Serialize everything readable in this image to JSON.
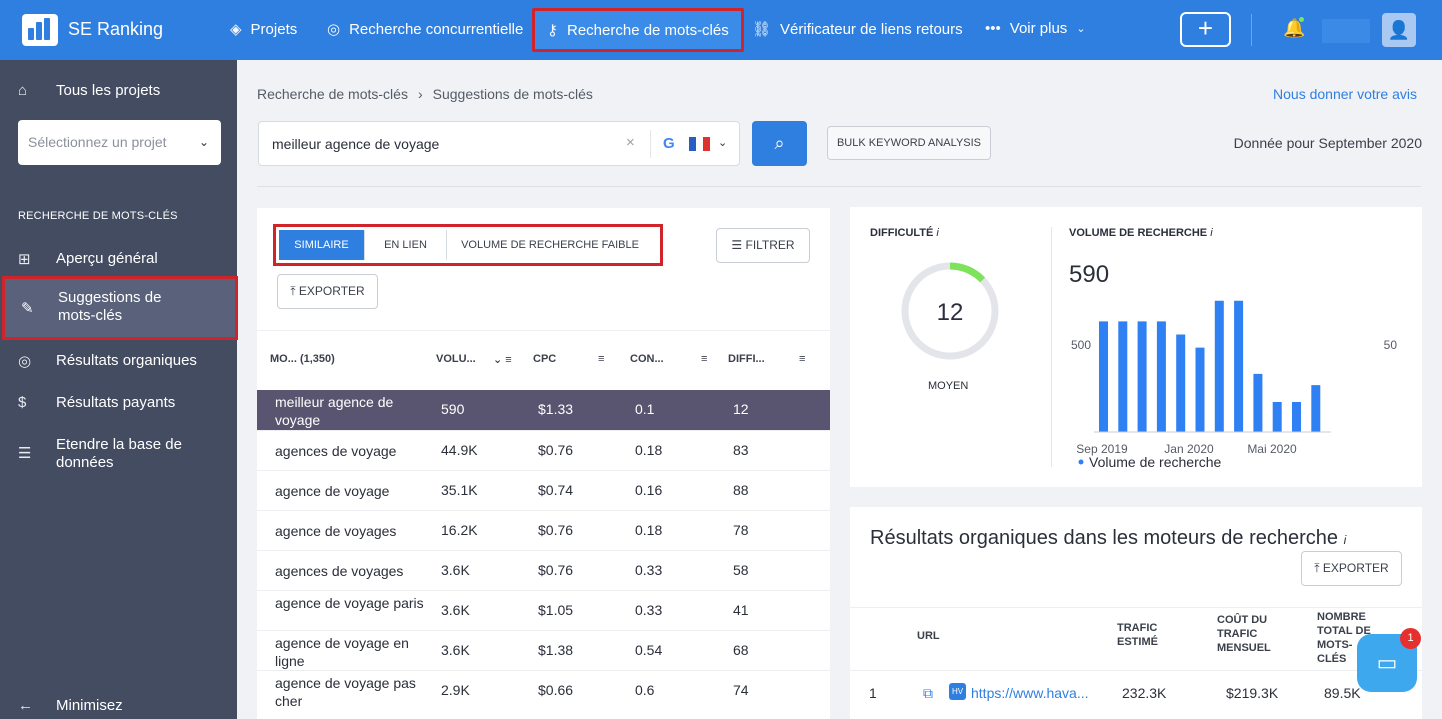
{
  "topbar": {
    "brand": "SE Ranking",
    "nav": [
      {
        "label": "Projets",
        "icon": "layers-icon"
      },
      {
        "label": "Recherche concurrentielle",
        "icon": "target-icon"
      },
      {
        "label": "Recherche de mots-clés",
        "icon": "key-icon"
      },
      {
        "label": "Vérificateur de liens retours",
        "icon": "link-icon"
      },
      {
        "label": "Voir plus",
        "icon": "more-icon"
      }
    ],
    "notification_icon": "bell-icon",
    "plus_label": "+"
  },
  "sidebar": {
    "all_projects": "Tous les projets",
    "select_placeholder": "Sélectionnez un projet",
    "section_header": "RECHERCHE DE MOTS-CLÉS",
    "items": [
      {
        "label": "Aperçu général"
      },
      {
        "label": "Suggestions de mots-clés"
      },
      {
        "label": "Résultats organiques"
      },
      {
        "label": "Résultats payants"
      },
      {
        "label": "Etendre la base de données"
      }
    ],
    "minimize": "Minimisez"
  },
  "main": {
    "breadcrumb": [
      "Recherche de mots-clés",
      "Suggestions de mots-clés"
    ],
    "feedback": "Nous donner votre avis",
    "search_value": "meilleur agence de voyage",
    "bulk_button": "BULK KEYWORD ANALYSIS",
    "data_date": "Donnée pour September 2020",
    "tabs": [
      "SIMILAIRE",
      "EN LIEN",
      "VOLUME DE RECHERCHE FAIBLE"
    ],
    "filter_button": "FILTRER",
    "export_button": "EXPORTER",
    "columns": [
      "MO... (1,350)",
      "VOLU...",
      "CPC",
      "CON...",
      "DIFFI..."
    ],
    "rows": [
      {
        "keyword": "meilleur agence de voyage",
        "volume": "590",
        "cpc": "$1.33",
        "competition": "0.1",
        "difficulty": "12"
      },
      {
        "keyword": "agences de voyage",
        "volume": "44.9K",
        "cpc": "$0.76",
        "competition": "0.18",
        "difficulty": "83"
      },
      {
        "keyword": "agence de voyage",
        "volume": "35.1K",
        "cpc": "$0.74",
        "competition": "0.16",
        "difficulty": "88"
      },
      {
        "keyword": "agence de voyages",
        "volume": "16.2K",
        "cpc": "$0.76",
        "competition": "0.18",
        "difficulty": "78"
      },
      {
        "keyword": "agences de voyages",
        "volume": "3.6K",
        "cpc": "$0.76",
        "competition": "0.33",
        "difficulty": "58"
      },
      {
        "keyword": "agence de voyage paris",
        "volume": "3.6K",
        "cpc": "$1.05",
        "competition": "0.33",
        "difficulty": "41"
      },
      {
        "keyword": "agence de voyage en ligne",
        "volume": "3.6K",
        "cpc": "$1.38",
        "competition": "0.54",
        "difficulty": "68"
      },
      {
        "keyword": "agence de voyage pas cher",
        "volume": "2.9K",
        "cpc": "$0.66",
        "competition": "0.6",
        "difficulty": "74"
      }
    ]
  },
  "overview": {
    "difficulty_label": "DIFFICULTÉ",
    "difficulty_value": "12",
    "difficulty_level": "MOYEN",
    "volume_label": "VOLUME DE RECHERCHE",
    "volume_value": "590",
    "legend": "Volume de recherche",
    "axis_left": "500",
    "axis_right": "50",
    "x_labels": [
      "Sep 2019",
      "Jan 2020",
      "Mai 2020"
    ]
  },
  "chart_data": {
    "type": "bar",
    "categories": [
      "Sep 2019",
      "",
      "",
      "",
      "Jan 2020",
      "",
      "",
      "",
      "Mai 2020",
      "",
      "",
      ""
    ],
    "values": [
      590,
      590,
      590,
      590,
      520,
      450,
      700,
      700,
      310,
      160,
      160,
      250
    ],
    "legend": [
      "Volume de recherche"
    ],
    "ylabel_left_tick": "500",
    "ylabel_right_tick": "50"
  },
  "organic": {
    "title": "Résultats organiques dans les moteurs de recherche",
    "export_button": "EXPORTER",
    "columns": [
      "URL",
      "TRAFIC ESTIMÉ",
      "COÛT DU TRAFIC MENSUEL",
      "NOMBRE TOTAL DE MOTS-CLÉS"
    ],
    "row": {
      "rank": "1",
      "url": "https://www.hava...",
      "traffic": "232.3K",
      "cost": "$219.3K",
      "keywords": "89.5K"
    }
  },
  "chat": {
    "badge": "1"
  },
  "colors": {
    "primary": "#2f7fe0",
    "sidebar": "#434c61",
    "highlight_border": "#d0232a",
    "selected_row": "#59546f",
    "gauge": "#7ee35b"
  }
}
